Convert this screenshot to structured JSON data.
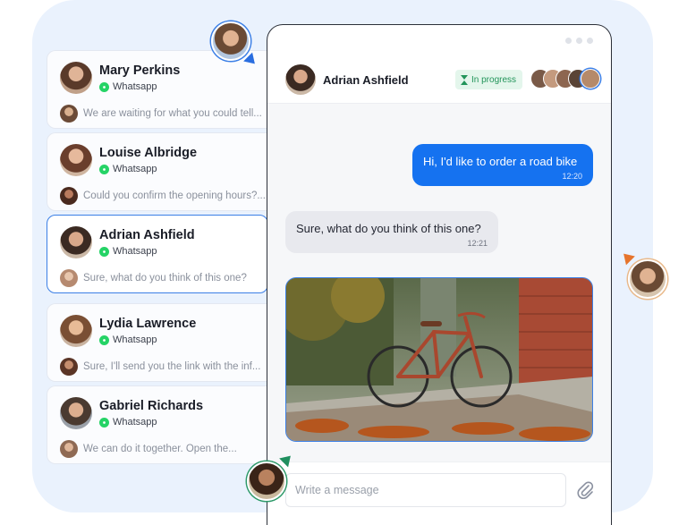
{
  "conversations": [
    {
      "name": "Mary Perkins",
      "channel": "Whatsapp",
      "preview": "We are waiting for what you could tell...",
      "avatar_color": "#8a5a3c",
      "preview_avatar_color": "#6b4a36"
    },
    {
      "name": "Louise Albridge",
      "channel": "Whatsapp",
      "preview": "Could you confirm the opening hours?...",
      "avatar_color": "#a86c4f",
      "preview_avatar_color": "#8c4a34"
    },
    {
      "name": "Adrian Ashfield",
      "channel": "Whatsapp",
      "preview": "Sure, what do you think of this one?",
      "avatar_color": "#5b4636",
      "preview_avatar_color": "#c49a7e"
    },
    {
      "name": "Lydia Lawrence",
      "channel": "Whatsapp",
      "preview": "Sure, I'll send you the link with the inf...",
      "avatar_color": "#9c7352",
      "preview_avatar_color": "#7d4e3a"
    },
    {
      "name": "Gabriel Richards",
      "channel": "Whatsapp",
      "preview": "We can do it together. Open the...",
      "avatar_color": "#6d5544",
      "preview_avatar_color": "#8f6a54"
    }
  ],
  "active_conversation_index": 2,
  "chat": {
    "contact_name": "Adrian Ashfield",
    "status": "In progress",
    "status_color": "#22945a",
    "messages": [
      {
        "direction": "outgoing",
        "text": "Hi, I'd like to order a road bike",
        "time": "12:20"
      },
      {
        "direction": "incoming",
        "text": "Sure, what do you think of this one?",
        "time": "12:21"
      }
    ],
    "attachment": "road bike photo",
    "composer_placeholder": "Write a message"
  },
  "colors": {
    "accent": "#1572f0",
    "active_border": "#3b7fe6",
    "whatsapp": "#25d366",
    "panel_bg": "#eaf2fd"
  },
  "icons": [
    "whatsapp-icon",
    "hourglass-icon",
    "paperclip-icon"
  ]
}
